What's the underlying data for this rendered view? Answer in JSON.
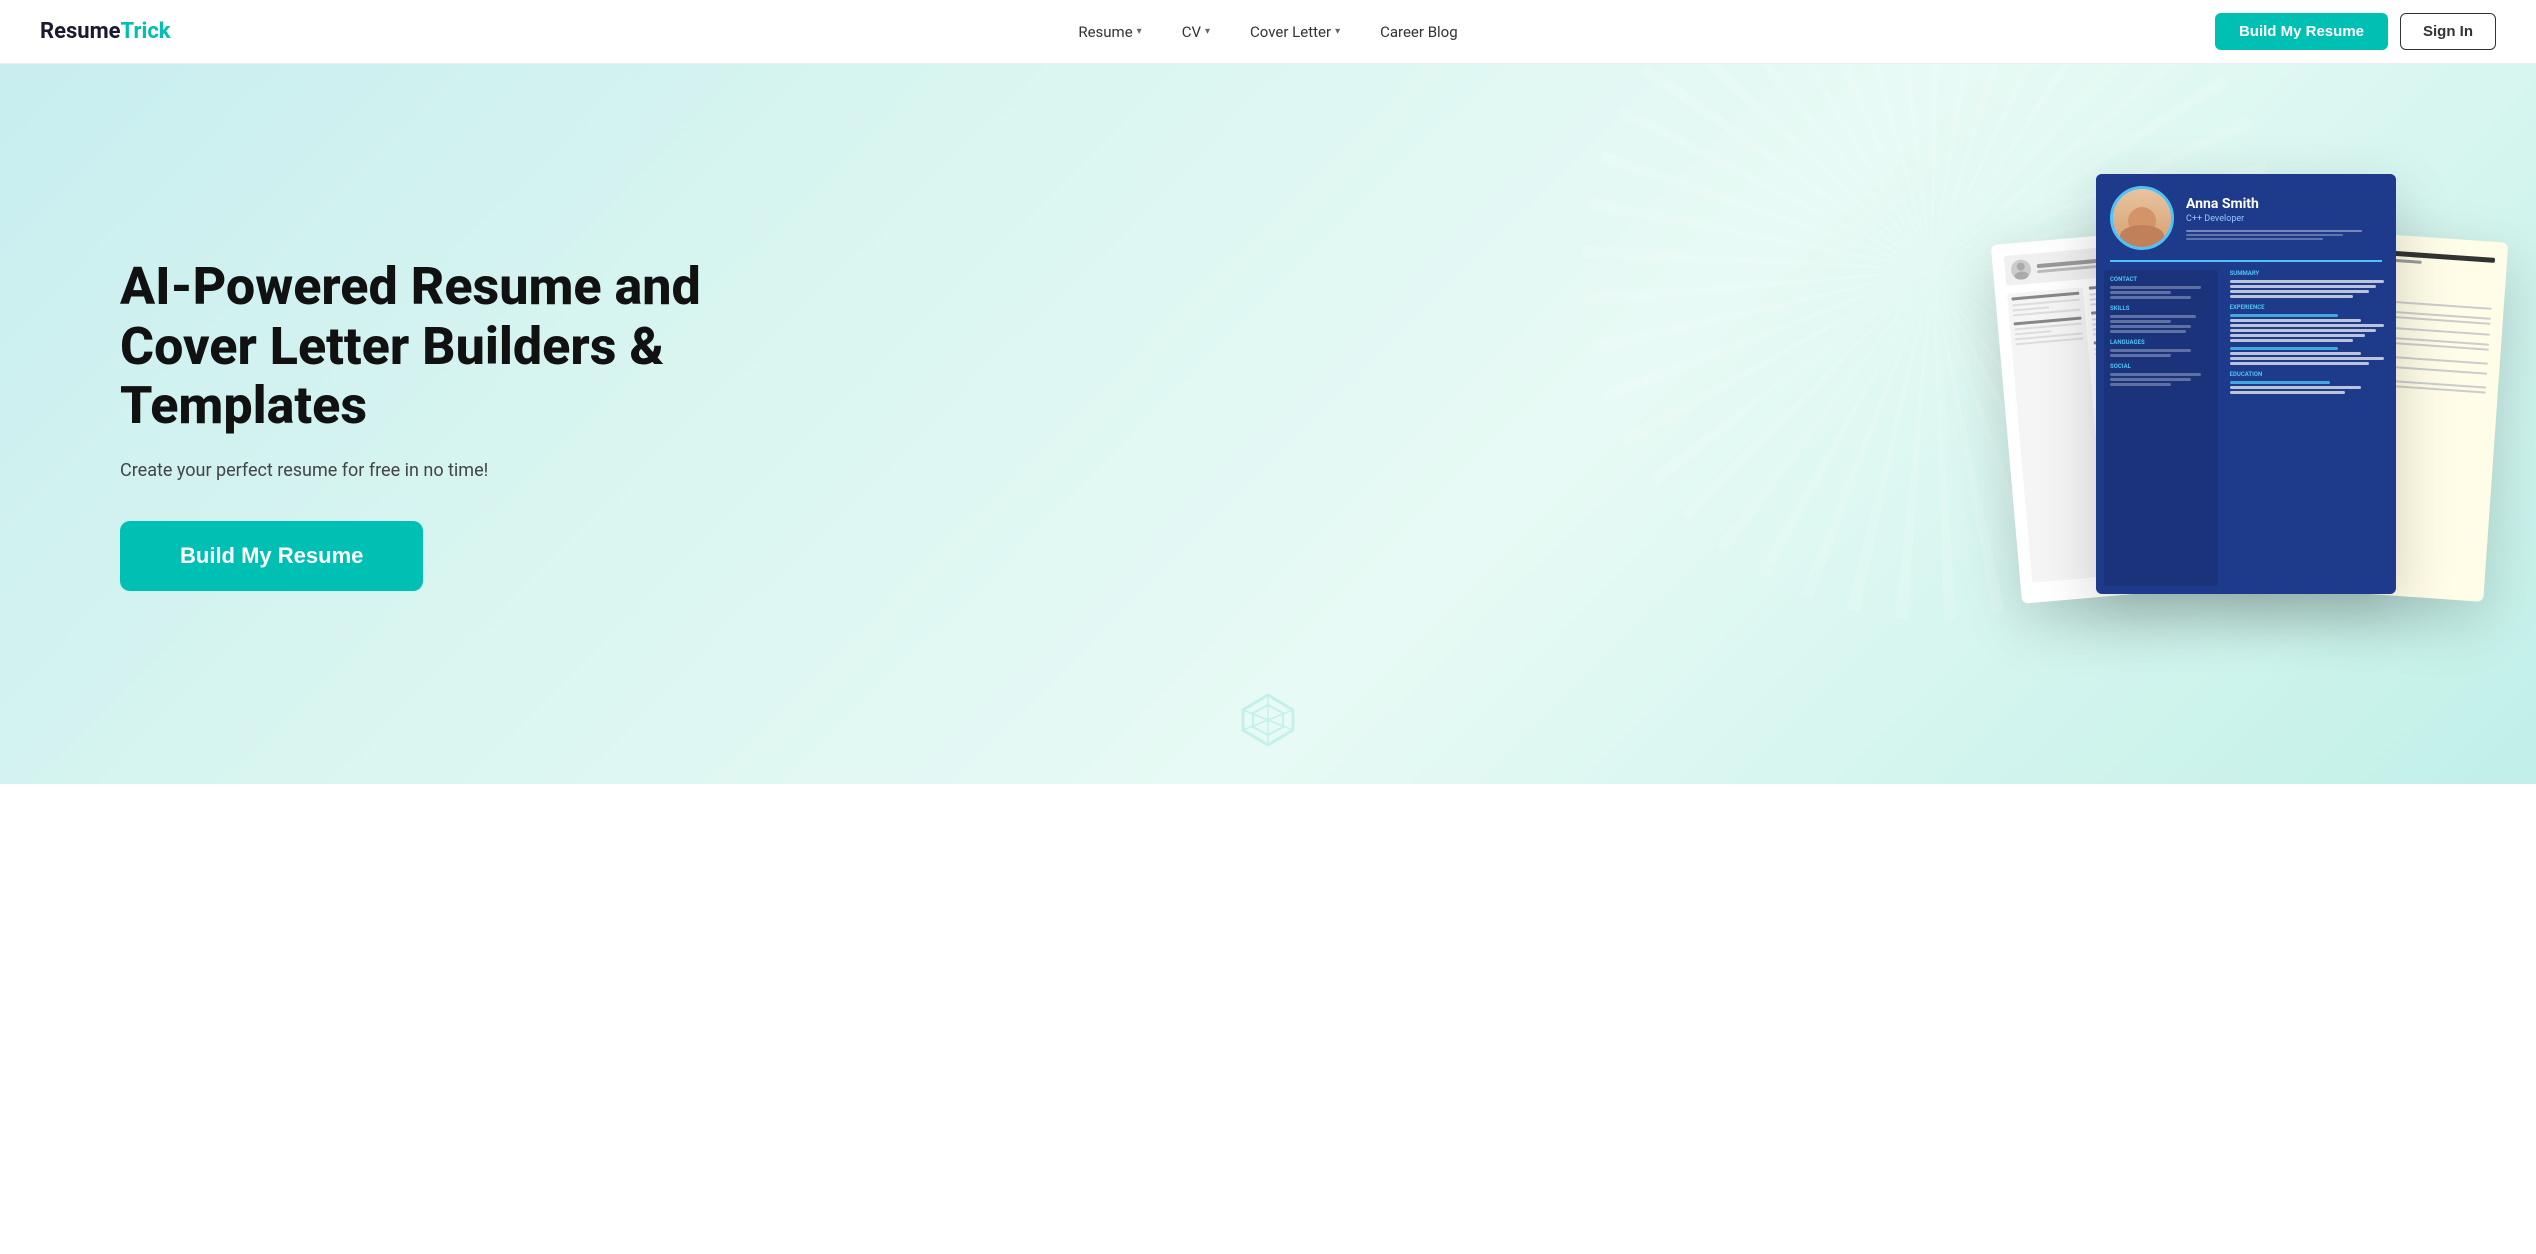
{
  "brand": {
    "name_part1": "Resume",
    "name_part2": "Trick"
  },
  "nav": {
    "items": [
      {
        "label": "Resume",
        "has_dropdown": true
      },
      {
        "label": "CV",
        "has_dropdown": true
      },
      {
        "label": "Cover Letter",
        "has_dropdown": true
      },
      {
        "label": "Career Blog",
        "has_dropdown": false
      }
    ]
  },
  "header": {
    "build_btn": "Build My Resume",
    "signin_btn": "Sign In"
  },
  "hero": {
    "title": "AI-Powered Resume and Cover Letter Builders & Templates",
    "subtitle": "Create your perfect resume for free in no time!",
    "cta_button": "Build My Resume"
  },
  "resume_mockup": {
    "name": "Anna Smith",
    "role": "C++ Developer"
  }
}
